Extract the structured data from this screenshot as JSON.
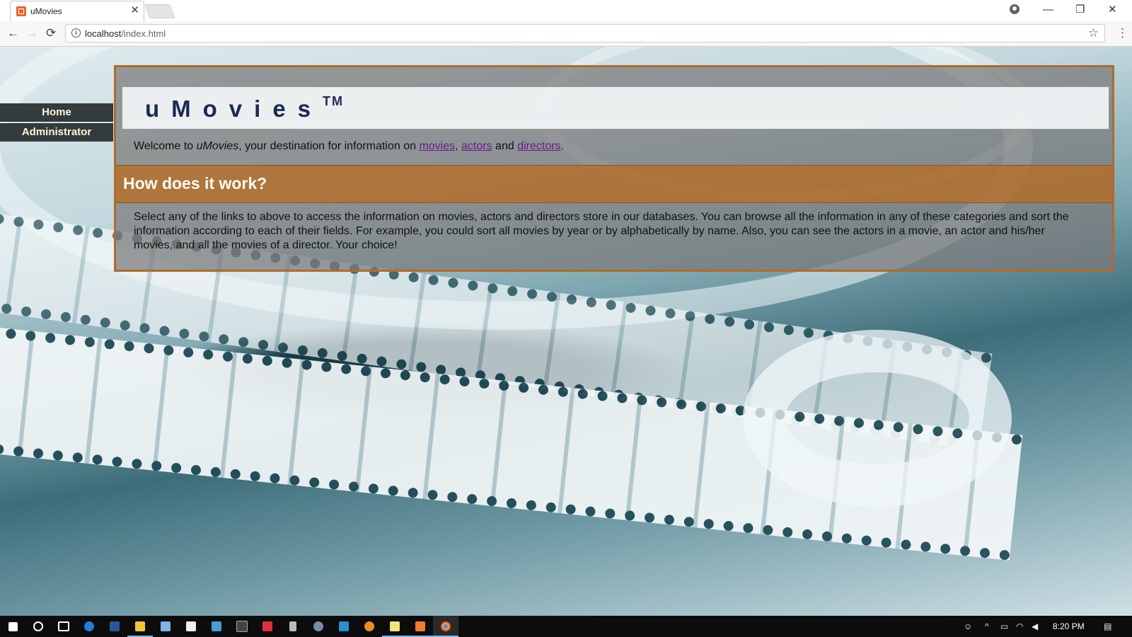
{
  "browser": {
    "tab_title": "uMovies",
    "tab_close": "✕",
    "url_host": "localhost",
    "url_path": "/index.html",
    "back": "←",
    "forward": "→",
    "reload": "⟳",
    "star": "☆",
    "menu": "⋮",
    "minimize": "—",
    "restore": "❐",
    "close": "✕"
  },
  "sidebar": {
    "items": [
      {
        "label": "Home"
      },
      {
        "label": "Administrator"
      }
    ]
  },
  "banner": {
    "title": "uMovies",
    "trademark": "TM"
  },
  "welcome": {
    "prefix": "Welcome to ",
    "brand": "uMovies",
    "middle": ", your destination for information on ",
    "link_movies": "movies",
    "comma": ", ",
    "link_actors": "actors",
    "and": " and ",
    "link_directors": "directors",
    "period": "."
  },
  "section": {
    "title": "How does it work?",
    "body": "Select any of the links to above to access the information on movies, actors and directors store in our databases. You can browse all the information in any of these categories and sort the information according to each of their fields. For example, you could sort all movies by year or by alphabetically by name. Also, you can see the actors in a movie, an actor and his/her movies, and all the movies of a director. Your choice!"
  },
  "taskbar": {
    "clock": "8:20 PM",
    "icons": [
      "windows-start-icon",
      "cortana-icon",
      "task-view-icon",
      "edge-icon",
      "word-icon",
      "file-explorer-icon",
      "notepad-icon",
      "store-icon",
      "outlook-icon",
      "amazon-icon",
      "toggl-icon",
      "media-icon",
      "sublime-icon",
      "remote-desktop-icon",
      "blender-icon",
      "notes-icon",
      "xampp-icon",
      "chrome-icon"
    ]
  },
  "colors": {
    "panel_border": "#b06b2d",
    "section_bar": "#b46e28",
    "sidebar_bg": "#333b3d",
    "link": "#6a1a8a"
  }
}
